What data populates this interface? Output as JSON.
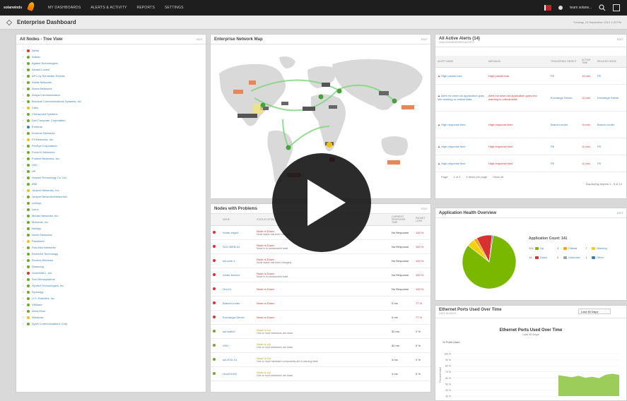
{
  "topbar": {
    "brand": "solarwinds",
    "nav": [
      "MY DASHBOARDS",
      "ALERTS & ACTIVITY",
      "REPORTS",
      "SETTINGS"
    ],
    "user": "team solarw..."
  },
  "page": {
    "title": "Enterprise Dashboard",
    "timestamp": "Tuesday, 23 September 2014 1:23 PM"
  },
  "tree_panel": {
    "title": "All Nodes - Tree View",
    "action": "EDIT",
    "items": [
      {
        "label": "Alerts",
        "status": "red"
      },
      {
        "label": "Adtran",
        "status": "green"
      },
      {
        "label": "Agilent Technologies",
        "status": "green"
      },
      {
        "label": "Alcatel-Lucent",
        "status": "green"
      },
      {
        "label": "APC by Schneider Electric",
        "status": "green"
      },
      {
        "label": "Arista Networks",
        "status": "green"
      },
      {
        "label": "Aruba Networks",
        "status": "green"
      },
      {
        "label": "Avaya Communication",
        "status": "green"
      },
      {
        "label": "Brocade Communications Systems, Inc.",
        "status": "green"
      },
      {
        "label": "Citrix",
        "status": "yellow"
      },
      {
        "label": "Checkpoint Systems",
        "status": "green"
      },
      {
        "label": "Dell Computer Corporation",
        "status": "green"
      },
      {
        "label": "Extreme",
        "status": "blue"
      },
      {
        "label": "Extreme Networks",
        "status": "green"
      },
      {
        "label": "F5 Networks, Inc.",
        "status": "yellow"
      },
      {
        "label": "FireEye Corporation",
        "status": "green"
      },
      {
        "label": "Force10 Networks",
        "status": "green"
      },
      {
        "label": "Fortinet Networks, Inc.",
        "status": "green"
      },
      {
        "label": "H3C",
        "status": "green"
      },
      {
        "label": "HP",
        "status": "green"
      },
      {
        "label": "Huawei Technology Co. Ltd.",
        "status": "green"
      },
      {
        "label": "IBM",
        "status": "green"
      },
      {
        "label": "Juniper Networks, Inc.",
        "status": "yellow"
      },
      {
        "label": "Juniper Networks/Netscreen",
        "status": "green"
      },
      {
        "label": "Linksys",
        "status": "green"
      },
      {
        "label": "Linux",
        "status": "green"
      },
      {
        "label": "Meraki Networks, Inc.",
        "status": "green"
      },
      {
        "label": "Motorola, Inc.",
        "status": "green"
      },
      {
        "label": "NetApp",
        "status": "green"
      },
      {
        "label": "Nortel Networks",
        "status": "green"
      },
      {
        "label": "Packeteer",
        "status": "yellow"
      },
      {
        "label": "Palo Alto Networks",
        "status": "green"
      },
      {
        "label": "Riverbed Technology",
        "status": "green"
      },
      {
        "label": "Ruckus Wireless",
        "status": "green"
      },
      {
        "label": "Samsung",
        "status": "green"
      },
      {
        "label": "SonicWALL, Inc.",
        "status": "red"
      },
      {
        "label": "Sun Microsystems",
        "status": "green"
      },
      {
        "label": "Symbol Technologies, Inc.",
        "status": "green"
      },
      {
        "label": "Synology",
        "status": "green"
      },
      {
        "label": "U.S. Robotics, Inc.",
        "status": "green"
      },
      {
        "label": "VMware",
        "status": "green"
      },
      {
        "label": "Wind River",
        "status": "green"
      },
      {
        "label": "Windows",
        "status": "yellow"
      },
      {
        "label": "Zyxel Communications Corp.",
        "status": "green"
      }
    ]
  },
  "map_panel": {
    "title": "Enterprise Network Map",
    "action": "EDIT"
  },
  "nodes_panel": {
    "title": "Nodes with Problems",
    "action": "EDIT",
    "headers": [
      "NODE",
      "STATUS DETAILS",
      "CURRENT RESPONSE TIME",
      "PACKET LOSS"
    ],
    "rows": [
      {
        "status": "red",
        "node": "router-edge1",
        "detail": "Node is Down",
        "detail2": "Node status has been changing",
        "response": "No Response",
        "loss": "100 %"
      },
      {
        "status": "red",
        "node": "SOL-WEB-02",
        "detail": "Node is Down",
        "detail2": "Node is in unreachable state",
        "response": "No Response",
        "loss": "100 %"
      },
      {
        "status": "red",
        "node": "sw-core-1",
        "detail": "Node is Down",
        "detail2": "Node status has been changing",
        "response": "No Response",
        "loss": "100 %"
      },
      {
        "status": "red",
        "node": "router-branch",
        "detail": "Node is Down",
        "detail2": "Node is in unreachable state",
        "response": "No Response",
        "loss": "100 %"
      },
      {
        "status": "red",
        "node": "Ora-01",
        "detail": "Node is Down",
        "detail2": "",
        "response": "No Response",
        "loss": "100 %"
      },
      {
        "status": "red",
        "node": "Branch-router",
        "detail": "Node is Down",
        "detail2": "",
        "response": "0 ms",
        "loss": "77 %"
      },
      {
        "status": "red",
        "node": "Exchange-Server",
        "detail": "Node is Down",
        "detail2": "",
        "response": "0 ms",
        "loss": "77 %"
      },
      {
        "status": "green",
        "node": "sol-switch",
        "detail": "Node is Up",
        "detail2": "One or more interfaces are down",
        "response": "30 ms",
        "loss": "0 %"
      },
      {
        "status": "green",
        "node": "VM1",
        "detail": "Node is Up",
        "detail2": "One or more interfaces are down",
        "response": "30 ms",
        "loss": "0 %"
      },
      {
        "status": "green",
        "node": "sol-ESX-01",
        "detail": "Node is Up",
        "detail2": "One or more hardware components are in warning state",
        "response": "4 ms",
        "loss": "0 %"
      },
      {
        "status": "green",
        "node": "Ora-EX002",
        "detail": "Node is Up",
        "detail2": "One or more interfaces are down",
        "response": "4 ms",
        "loss": "0 %"
      }
    ]
  },
  "alerts_panel": {
    "title": "All Active Alerts (14)",
    "subtitle": "UNACKNOWLEDGED ALERTS",
    "action": "EDIT",
    "headers": [
      "ALERT NAME",
      "MESSAGE",
      "TRIGGERING OBJECT",
      "ACTIVE TIME",
      "RELATED NODE"
    ],
    "rows": [
      {
        "name": "High packet loss",
        "message": "High packet loss",
        "object": "PE",
        "time": "13 min",
        "node": "PE"
      },
      {
        "name": "Alert me when an application goes into warning or critical state",
        "message": "Alert me when an application goes into warning or critical state",
        "object": "Exchange Server",
        "time": "11 min",
        "node": "Exchange Server"
      },
      {
        "name": "High response time",
        "message": "High response time",
        "object": "Branch router",
        "time": "11 min",
        "node": "Branch router"
      },
      {
        "name": "High response time",
        "message": "High response time",
        "object": "PE",
        "time": "11 min",
        "node": "PE"
      },
      {
        "name": "High response time",
        "message": "High response time",
        "object": "PE",
        "time": "11 min",
        "node": "PE"
      }
    ],
    "pager": [
      "Page",
      "1 of 3",
      "5 items per page",
      "Show all"
    ],
    "summary": "Displaying objects 1 - 5 of 14"
  },
  "health_panel": {
    "title": "Application Health Overview",
    "action": "EDIT",
    "legend_title": "Application Count: 141",
    "legend": [
      {
        "count": "124",
        "label": "Up",
        "color": "#7ab800"
      },
      {
        "count": "3",
        "label": "Critical",
        "color": "#ffa500"
      },
      {
        "count": "7",
        "label": "Warning",
        "color": "#f5d000"
      },
      {
        "count": "14",
        "label": "Down",
        "color": "#d93030"
      },
      {
        "count": "0",
        "label": "Unknown",
        "color": "#9aa3ab"
      },
      {
        "count": "1",
        "label": "Other",
        "color": "#3c7fb5"
      }
    ],
    "chart_data": {
      "type": "pie",
      "labels": [
        "Up",
        "Warning",
        "Critical",
        "Down",
        "Other",
        "Unknown"
      ],
      "values": [
        124,
        7,
        3,
        14,
        1,
        0
      ],
      "colors": [
        "#7ab800",
        "#f5d000",
        "#ffa500",
        "#d93030",
        "#3c7fb5",
        "#9aa3ab"
      ]
    }
  },
  "ports_panel": {
    "title": "Ethernet Ports Used Over Time",
    "subtitle": "LAST 30 DAYS",
    "period": "Last 30 Days",
    "chart_title": "Ethernet Ports Used Over Time",
    "chart_subtitle": "Last 30 Days",
    "series_label": "% Ports Used",
    "ylabel": "Percent Used",
    "chart_data": {
      "type": "area",
      "yticks": [
        "100 %",
        "90 %",
        "80 %",
        "70 %",
        "60 %",
        "50 %",
        "40 %",
        "30 %"
      ],
      "values": [
        0.82,
        0.78,
        0.74,
        0.8,
        0.72,
        0.76,
        0.7,
        0.84,
        0.88,
        0.83
      ]
    }
  },
  "colors": {
    "up": "#6aaa2a",
    "down": "#d93030",
    "warning": "#f2c200",
    "link": "#3c7fb5"
  }
}
